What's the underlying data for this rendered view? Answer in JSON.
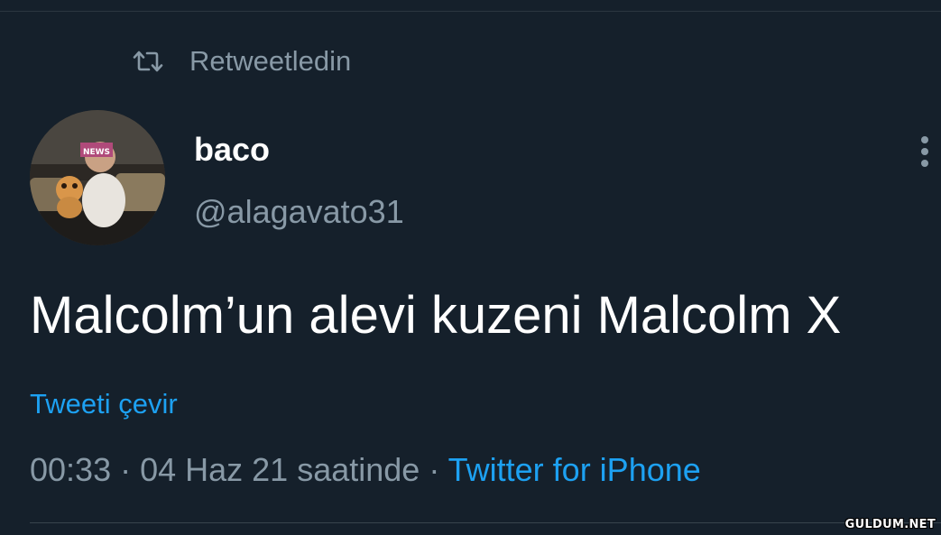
{
  "retweet": {
    "label": "Retweetledin",
    "icon": "retweet-icon"
  },
  "author": {
    "display_name": "baco",
    "handle": "@alagavato31",
    "avatar_badge": "NEWS"
  },
  "tweet": {
    "text": "Malcolm’un alevi kuzeni Malcolm X",
    "translate_label": "Tweeti çevir"
  },
  "meta": {
    "time": "00:33",
    "separator1": " · ",
    "date_text": "04 Haz 21 saatinde",
    "separator2": " · ",
    "source": "Twitter for iPhone"
  },
  "menu": {
    "icon": "more-vertical-icon"
  },
  "watermark": "GULDUM.NET",
  "colors": {
    "background": "#15202b",
    "text_primary": "#ffffff",
    "text_secondary": "#8899a6",
    "link": "#1da1f2",
    "divider": "#38444d"
  }
}
